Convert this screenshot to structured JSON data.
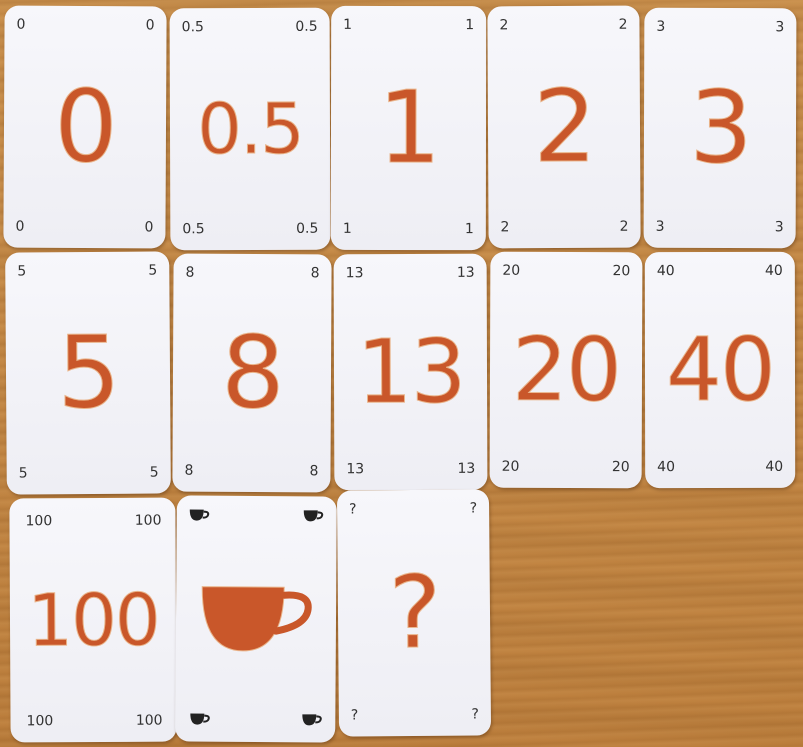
{
  "colors": {
    "card_face": "#f2f2f7",
    "accent_orange": "#c9572a",
    "corner_text": "#333333",
    "wood": "#c48845"
  },
  "cards": [
    {
      "value": "0"
    },
    {
      "value": "0.5"
    },
    {
      "value": "1"
    },
    {
      "value": "2"
    },
    {
      "value": "3"
    },
    {
      "value": "5"
    },
    {
      "value": "8"
    },
    {
      "value": "13"
    },
    {
      "value": "20"
    },
    {
      "value": "40"
    },
    {
      "value": "100"
    },
    {
      "value": "",
      "icon": "coffee-cup-icon"
    },
    {
      "value": "?"
    }
  ]
}
